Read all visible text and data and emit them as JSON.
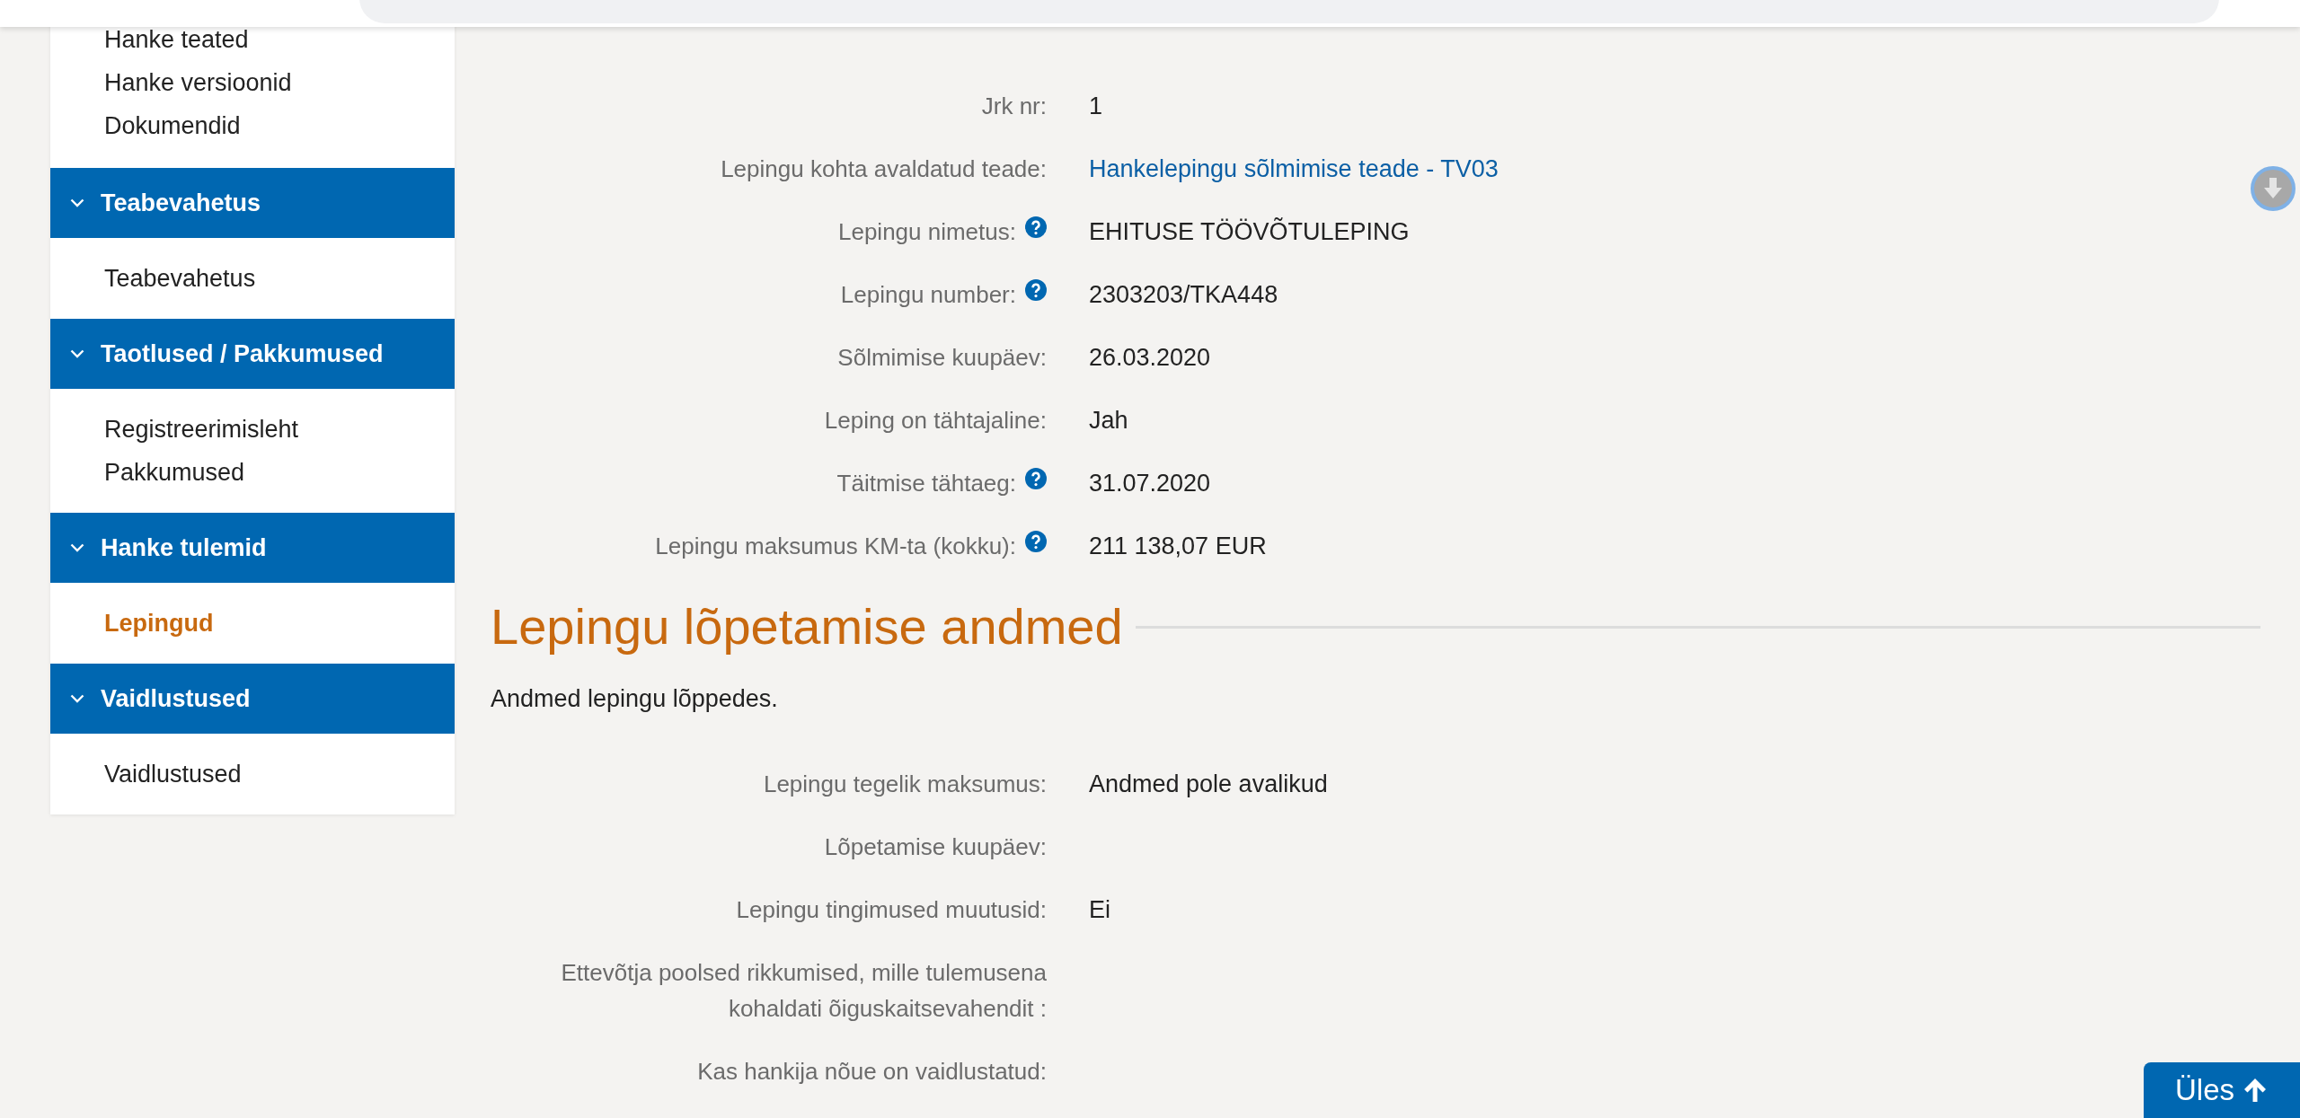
{
  "sidebar": {
    "leading_items": [
      {
        "label": "Hanke teated",
        "selected": false
      },
      {
        "label": "Hanke versioonid",
        "selected": false
      },
      {
        "label": "Dokumendid",
        "selected": false
      }
    ],
    "sections": [
      {
        "title": "Teabevahetus",
        "expanded": true,
        "items": [
          {
            "label": "Teabevahetus",
            "selected": false
          }
        ]
      },
      {
        "title": "Taotlused / Pakkumused",
        "expanded": true,
        "items": [
          {
            "label": "Registreerimisleht",
            "selected": false
          },
          {
            "label": "Pakkumused",
            "selected": false
          }
        ]
      },
      {
        "title": "Hanke tulemid",
        "expanded": true,
        "items": [
          {
            "label": "Lepingud",
            "selected": true
          }
        ]
      },
      {
        "title": "Vaidlustused",
        "expanded": true,
        "items": [
          {
            "label": "Vaidlustused",
            "selected": false
          }
        ]
      }
    ]
  },
  "contract_details": [
    {
      "label": "Jrk nr:",
      "help": false,
      "kind": "text",
      "value": "1"
    },
    {
      "label": "Lepingu kohta avaldatud teade:",
      "help": false,
      "kind": "link",
      "value": "Hankelepingu sõlmimise teade - TV03"
    },
    {
      "label": "Lepingu nimetus:",
      "help": true,
      "kind": "text",
      "value": "EHITUSE TÖÖVÕTULEPING"
    },
    {
      "label": "Lepingu number:",
      "help": true,
      "kind": "text",
      "value": "2303203/TKA448"
    },
    {
      "label": "Sõlmimise kuupäev:",
      "help": false,
      "kind": "text",
      "value": "26.03.2020"
    },
    {
      "label": "Leping on tähtajaline:",
      "help": false,
      "kind": "text",
      "value": "Jah"
    },
    {
      "label": "Täitmise tähtaeg:",
      "help": true,
      "kind": "text",
      "value": "31.07.2020"
    },
    {
      "label": "Lepingu maksumus KM-ta (kokku):",
      "help": true,
      "kind": "text",
      "value": "211 138,07 EUR"
    }
  ],
  "termination": {
    "title": "Lepingu lõpetamise andmed",
    "description": "Andmed lepingu lõppedes.",
    "rows": [
      {
        "label": "Lepingu tegelik maksumus:",
        "help": false,
        "kind": "text",
        "value": "Andmed pole avalikud"
      },
      {
        "label": "Lõpetamise kuupäev:",
        "help": false
      },
      {
        "label": "Lepingu tingimused muutusid:",
        "help": false,
        "kind": "text",
        "value": "Ei"
      },
      {
        "label": "Ettevõtja poolsed rikkumised, mille tulemusena kohaldati õiguskaitsevahendit :",
        "help": false
      },
      {
        "label": "Kas hankija nõue on vaidlustatud:",
        "help": false
      }
    ]
  },
  "back_to_top": {
    "label": "Üles"
  }
}
